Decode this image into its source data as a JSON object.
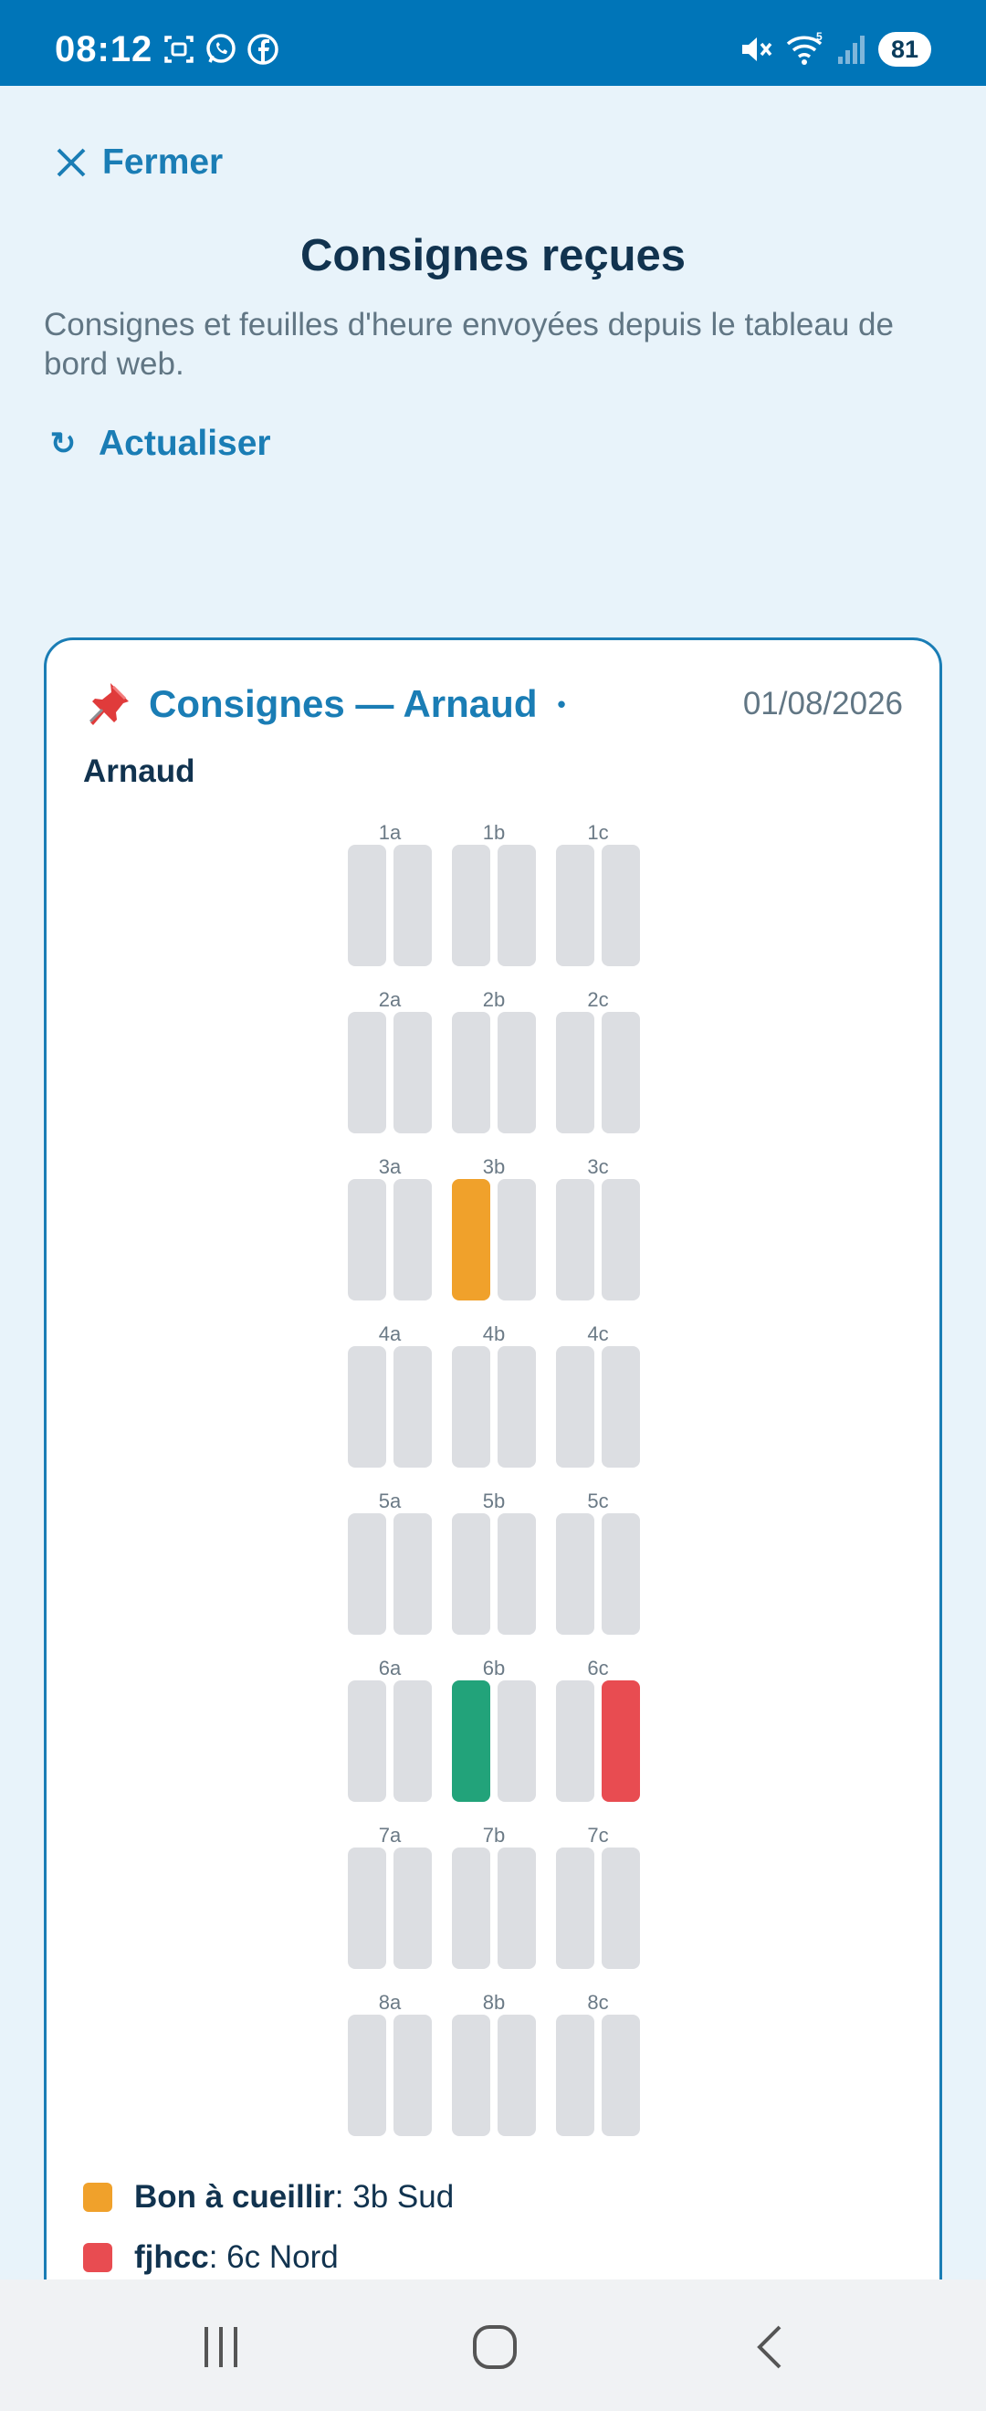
{
  "status_bar": {
    "time": "08:12",
    "left_icons": [
      "screenshot-icon",
      "whatsapp-icon",
      "facebook-icon"
    ],
    "right_icons": [
      "mute-icon",
      "wifi-icon",
      "signal-icon"
    ],
    "battery": "81"
  },
  "header": {
    "close_label": "Fermer",
    "title": "Consignes reçues",
    "subtitle": "Consignes et feuilles d'heure envoyées depuis le tableau de bord web.",
    "refresh_label": "Actualiser"
  },
  "card": {
    "title": "Consignes — Arnaud",
    "dot": "•",
    "date": "01/08/2026",
    "owner": "Arnaud",
    "grid": [
      {
        "row": 1,
        "groups": [
          {
            "label": "1a",
            "tiles": [
              "",
              ""
            ]
          },
          {
            "label": "1b",
            "tiles": [
              "",
              ""
            ]
          },
          {
            "label": "1c",
            "tiles": [
              "",
              ""
            ]
          }
        ]
      },
      {
        "row": 2,
        "groups": [
          {
            "label": "2a",
            "tiles": [
              "",
              ""
            ]
          },
          {
            "label": "2b",
            "tiles": [
              "",
              ""
            ]
          },
          {
            "label": "2c",
            "tiles": [
              "",
              ""
            ]
          }
        ]
      },
      {
        "row": 3,
        "groups": [
          {
            "label": "3a",
            "tiles": [
              "",
              ""
            ]
          },
          {
            "label": "3b",
            "tiles": [
              "#f0a12b",
              ""
            ]
          },
          {
            "label": "3c",
            "tiles": [
              "",
              ""
            ]
          }
        ]
      },
      {
        "row": 4,
        "groups": [
          {
            "label": "4a",
            "tiles": [
              "",
              ""
            ]
          },
          {
            "label": "4b",
            "tiles": [
              "",
              ""
            ]
          },
          {
            "label": "4c",
            "tiles": [
              "",
              ""
            ]
          }
        ]
      },
      {
        "row": 5,
        "groups": [
          {
            "label": "5a",
            "tiles": [
              "",
              ""
            ]
          },
          {
            "label": "5b",
            "tiles": [
              "",
              ""
            ]
          },
          {
            "label": "5c",
            "tiles": [
              "",
              ""
            ]
          }
        ]
      },
      {
        "row": 6,
        "groups": [
          {
            "label": "6a",
            "tiles": [
              "",
              ""
            ]
          },
          {
            "label": "6b",
            "tiles": [
              "#22a37a",
              ""
            ]
          },
          {
            "label": "6c",
            "tiles": [
              "",
              "#e84c51"
            ]
          }
        ]
      },
      {
        "row": 7,
        "groups": [
          {
            "label": "7a",
            "tiles": [
              "",
              ""
            ]
          },
          {
            "label": "7b",
            "tiles": [
              "",
              ""
            ]
          },
          {
            "label": "7c",
            "tiles": [
              "",
              ""
            ]
          }
        ]
      },
      {
        "row": 8,
        "groups": [
          {
            "label": "8a",
            "tiles": [
              "",
              ""
            ]
          },
          {
            "label": "8b",
            "tiles": [
              "",
              ""
            ]
          },
          {
            "label": "8c",
            "tiles": [
              "",
              ""
            ]
          }
        ]
      }
    ],
    "legend": [
      {
        "color": "#f0a12b",
        "name": "Bon à cueillir",
        "detail": " : 3b Sud"
      },
      {
        "color": "#e84c51",
        "name": "fjhcc",
        "detail": " : 6c Nord"
      }
    ]
  },
  "colors": {
    "accent": "#1a7db5",
    "status_bar": "#0075b8",
    "tile_empty": "#dcdee2",
    "background": "#e8f3fa"
  },
  "nav_bar": {
    "buttons": [
      "recent-apps-icon",
      "home-icon",
      "back-icon"
    ]
  }
}
